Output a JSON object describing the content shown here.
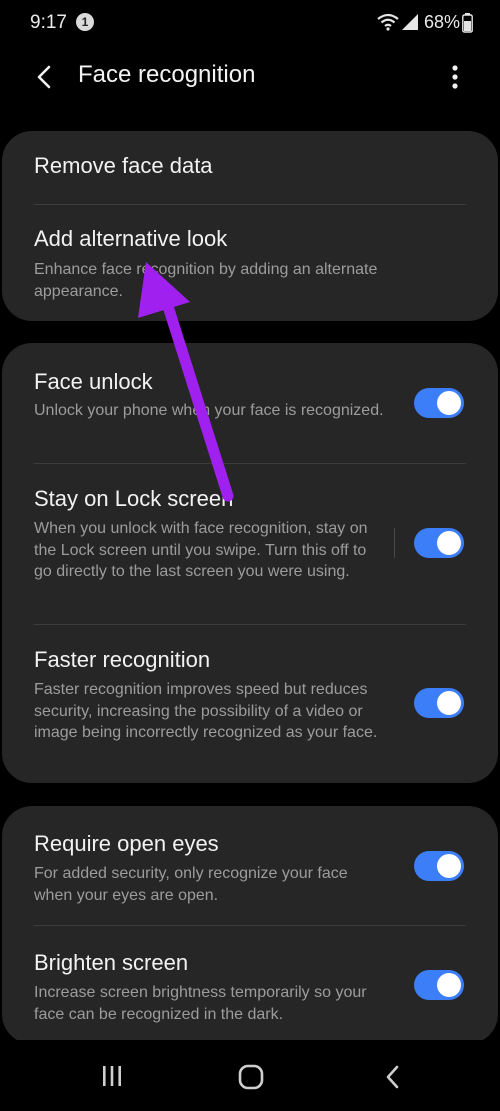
{
  "status_bar": {
    "time": "9:17",
    "notification_count": "1",
    "battery": "68%"
  },
  "header": {
    "title": "Face recognition",
    "back_icon": "back-arrow-icon",
    "more_icon": "more-vertical-icon"
  },
  "card1": {
    "remove_face_data": "Remove face data",
    "add_alternative_look": {
      "title": "Add alternative look",
      "description": "Enhance face recognition by adding an alternate appearance."
    }
  },
  "card2": {
    "face_unlock": {
      "title": "Face unlock",
      "description": "Unlock your phone when your face is recognized.",
      "enabled": true
    },
    "stay_on_lock_screen": {
      "title": "Stay on Lock screen",
      "description": "When you unlock with face recognition, stay on the Lock screen until you swipe. Turn this off to go directly to the last screen you were using.",
      "enabled": true
    },
    "faster_recognition": {
      "title": "Faster recognition",
      "description": "Faster recognition improves speed but reduces security, increasing the possibility of a video or image being incorrectly recognized as your face.",
      "enabled": true
    }
  },
  "card3": {
    "require_open_eyes": {
      "title": "Require open eyes",
      "description": "For added security, only recognize your face when your eyes are open.",
      "enabled": true
    },
    "brighten_screen": {
      "title": "Brighten screen",
      "description": "Increase screen brightness temporarily so your face can be recognized in the dark.",
      "enabled": true
    }
  },
  "nav_bar": {
    "recent_icon": "recent-apps-icon",
    "home_icon": "home-icon",
    "back_icon": "nav-back-icon"
  },
  "colors": {
    "background": "#000000",
    "card": "#262626",
    "toggle_on": "#3c7ef7",
    "annotation_arrow": "#a020f0"
  }
}
